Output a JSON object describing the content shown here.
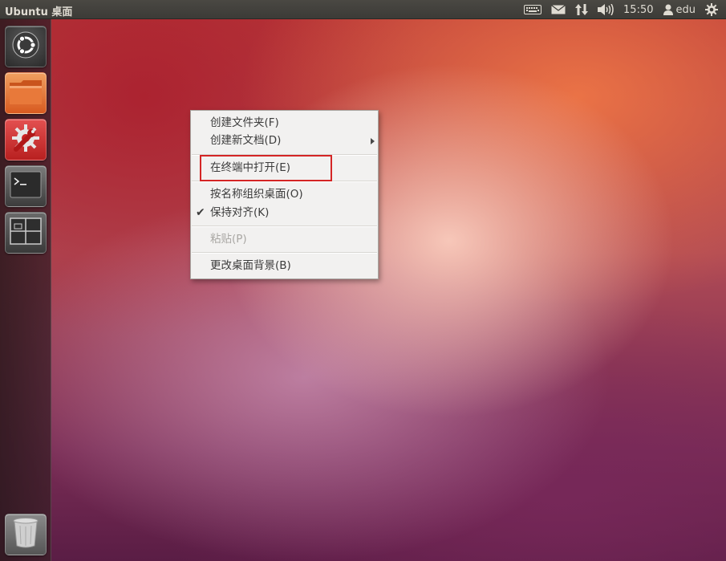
{
  "top_panel": {
    "title": "Ubuntu 桌面",
    "clock": "15:50",
    "user": "edu",
    "icons": [
      "keyboard-icon",
      "mail-icon",
      "network-icon",
      "volume-icon",
      "user-icon",
      "gear-icon"
    ]
  },
  "launcher": {
    "items": [
      {
        "name": "dash-home",
        "icon": "ubuntu-logo-icon"
      },
      {
        "name": "files",
        "icon": "folder-icon"
      },
      {
        "name": "system-settings",
        "icon": "settings-wrench-icon"
      },
      {
        "name": "terminal",
        "icon": "terminal-icon"
      },
      {
        "name": "workspaces",
        "icon": "workspace-switcher-icon"
      },
      {
        "name": "trash",
        "icon": "trash-icon"
      }
    ]
  },
  "context_menu": {
    "items": [
      {
        "label": "创建文件夹(F)"
      },
      {
        "label": "创建新文档(D)",
        "has_submenu": true
      },
      {
        "label": "在终端中打开(E)",
        "annotated": true
      },
      {
        "label": "按名称组织桌面(O)"
      },
      {
        "label": "保持对齐(K)",
        "checked": true
      },
      {
        "label": "粘贴(P)",
        "disabled": true
      },
      {
        "label": "更改桌面背景(B)"
      }
    ],
    "check_glyph": "✔"
  },
  "colors": {
    "annotation_red": "#d42525",
    "panel": "#3c3b37",
    "menu_bg": "#f2f1f0"
  }
}
